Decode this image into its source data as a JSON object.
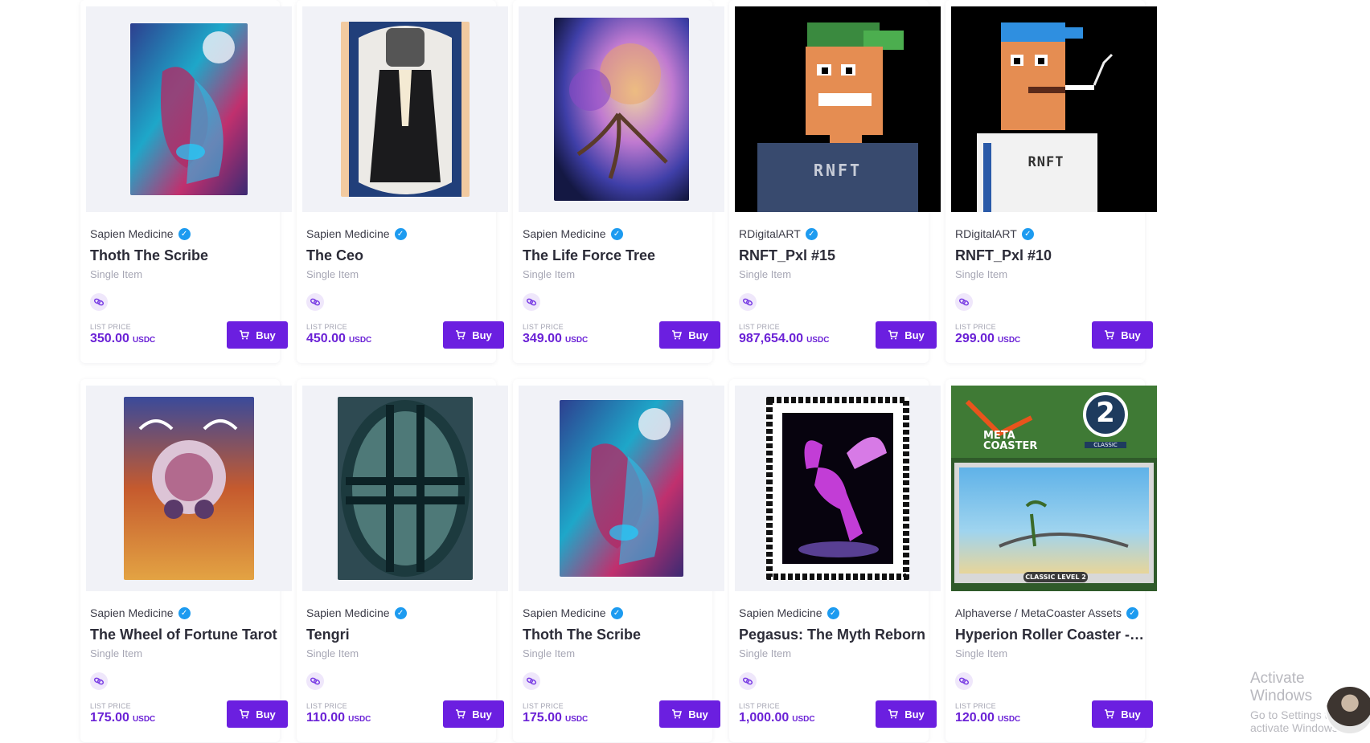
{
  "items": [
    {
      "creator": "Sapien Medicine",
      "title": "Thoth The Scribe",
      "subtitle": "Single Item",
      "price_label": "LIST PRICE",
      "price": "350.00",
      "currency": "USDC",
      "buy_label": "Buy"
    },
    {
      "creator": "Sapien Medicine",
      "title": "The Ceo",
      "subtitle": "Single Item",
      "price_label": "LIST PRICE",
      "price": "450.00",
      "currency": "USDC",
      "buy_label": "Buy"
    },
    {
      "creator": "Sapien Medicine",
      "title": "The Life Force Tree",
      "subtitle": "Single Item",
      "price_label": "LIST PRICE",
      "price": "349.00",
      "currency": "USDC",
      "buy_label": "Buy"
    },
    {
      "creator": "RDigitalART",
      "title": "RNFT_Pxl #15",
      "subtitle": "Single Item",
      "price_label": "LIST PRICE",
      "price": "987,654.00",
      "currency": "USDC",
      "buy_label": "Buy",
      "art_text": "RNFT"
    },
    {
      "creator": "RDigitalART",
      "title": "RNFT_Pxl #10",
      "subtitle": "Single Item",
      "price_label": "LIST PRICE",
      "price": "299.00",
      "currency": "USDC",
      "buy_label": "Buy",
      "art_text": "RNFT"
    },
    {
      "creator": "Sapien Medicine",
      "title": "The Wheel of Fortune Tarot",
      "subtitle": "Single Item",
      "price_label": "LIST PRICE",
      "price": "175.00",
      "currency": "USDC",
      "buy_label": "Buy"
    },
    {
      "creator": "Sapien Medicine",
      "title": "Tengri",
      "subtitle": "Single Item",
      "price_label": "LIST PRICE",
      "price": "110.00",
      "currency": "USDC",
      "buy_label": "Buy"
    },
    {
      "creator": "Sapien Medicine",
      "title": "Thoth The Scribe",
      "subtitle": "Single Item",
      "price_label": "LIST PRICE",
      "price": "175.00",
      "currency": "USDC",
      "buy_label": "Buy"
    },
    {
      "creator": "Sapien Medicine",
      "title": "Pegasus: The Myth Reborn",
      "subtitle": "Single Item",
      "price_label": "LIST PRICE",
      "price": "1,000.00",
      "currency": "USDC",
      "buy_label": "Buy"
    },
    {
      "creator": "Alphaverse / MetaCoaster Assets",
      "title": "Hyperion Roller Coaster - L...",
      "subtitle": "Single Item",
      "price_label": "LIST PRICE",
      "price": "120.00",
      "currency": "USDC",
      "buy_label": "Buy",
      "art_text": "META COASTER",
      "art_badge": "2",
      "art_badge_label": "CLASSIC",
      "art_caption": "CLASSIC LEVEL 2"
    }
  ],
  "system": {
    "activate_line1": "Activate Windows",
    "activate_line2": "Go to Settings to activate Windows."
  },
  "colors": {
    "accent": "#6b1fe0",
    "price": "#6b22d6",
    "verified": "#1d9bf0"
  },
  "icons": {
    "verified": "verified-badge-icon",
    "chain": "link-chain-icon",
    "cart": "cart-icon"
  }
}
